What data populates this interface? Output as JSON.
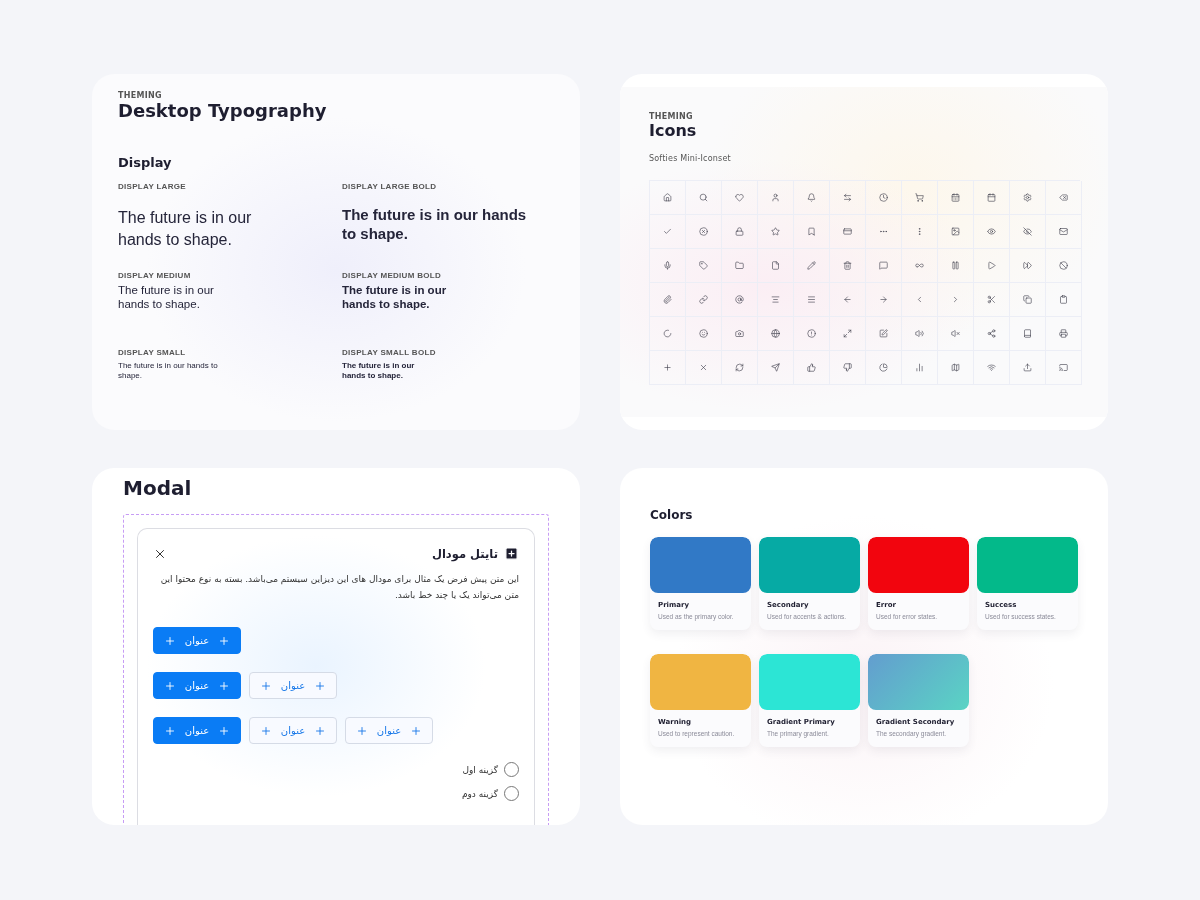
{
  "typography": {
    "overline": "THEMING",
    "title": "Desktop Typography",
    "section": "Display",
    "samples": [
      {
        "label": "DISPLAY LARGE",
        "text": "The future is in our hands to shape.",
        "kind": "large",
        "bold": false
      },
      {
        "label": "DISPLAY LARGE BOLD",
        "text": "The future is in our hands to shape.",
        "kind": "large",
        "bold": true
      },
      {
        "label": "DISPLAY MEDIUM",
        "text": "The future is in our hands to shape.",
        "kind": "medium",
        "bold": false
      },
      {
        "label": "DISPLAY MEDIUM BOLD",
        "text": "The future is in our hands to shape.",
        "kind": "medium",
        "bold": true
      },
      {
        "label": "DISPLAY SMALL",
        "text": "The future is in our hands to shape.",
        "kind": "small",
        "bold": false
      },
      {
        "label": "DISPLAY SMALL BOLD",
        "text": "The future is in our hands to shape.",
        "kind": "small",
        "bold": true
      }
    ]
  },
  "icons": {
    "overline": "THEMING",
    "title": "Icons",
    "subtitle": "Softies Mini-Iconset"
  },
  "modal": {
    "title": "Modal",
    "dialog": {
      "title": "تایتل مودال",
      "body": "این متن پیش فرض یک مثال برای مودال های این دیزاین سیستم می‌باشد. بسته به نوع محتوا این متن می‌تواند یک یا چند خط باشد.",
      "button_rows": [
        [
          {
            "label": "عنوان",
            "kind": "primary"
          }
        ],
        [
          {
            "label": "عنوان",
            "kind": "outline"
          },
          {
            "label": "عنوان",
            "kind": "primary"
          }
        ],
        [
          {
            "label": "عنوان",
            "kind": "outline"
          },
          {
            "label": "عنوان",
            "kind": "outline"
          },
          {
            "label": "عنوان",
            "kind": "primary"
          }
        ]
      ],
      "options": [
        {
          "label": "گزینه اول",
          "selected": false
        },
        {
          "label": "گزینه دوم",
          "selected": false
        }
      ]
    }
  },
  "colors": {
    "title": "Colors",
    "swatches": [
      {
        "name": "Primary",
        "description": "Used as the primary color.",
        "color": "#3179c6"
      },
      {
        "name": "Secondary",
        "description": "Used for accents & actions.",
        "color": "#06aaa4"
      },
      {
        "name": "Error",
        "description": "Used for error states.",
        "color": "#f2050e"
      },
      {
        "name": "Success",
        "description": "Used for success states.",
        "color": "#03b98a"
      },
      {
        "name": "Warning",
        "description": "Used to represent caution.",
        "color": "#f0b542"
      },
      {
        "name": "Gradient Primary",
        "description": "The primary gradient.",
        "color": "#2ce5d5"
      },
      {
        "name": "Gradient Secondary",
        "description": "The secondary gradient.",
        "stops": [
          {
            "color": "#639dcf"
          },
          {
            "color": "#5ad4c4"
          }
        ]
      }
    ]
  }
}
